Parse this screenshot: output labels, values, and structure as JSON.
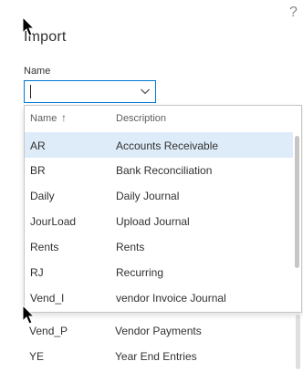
{
  "dialog": {
    "title": "Import",
    "help_icon": "question-mark-icon",
    "help_glyph": "?"
  },
  "name_field": {
    "label": "Name",
    "value": "",
    "icon": "chevron-down-icon"
  },
  "dropdown": {
    "headers": {
      "name": "Name",
      "sort_glyph": "↑",
      "description": "Description"
    },
    "rows": [
      {
        "name": "AR",
        "description": "Accounts Receivable",
        "selected": true
      },
      {
        "name": "BR",
        "description": "Bank Reconciliation"
      },
      {
        "name": "Daily",
        "description": "Daily Journal"
      },
      {
        "name": "JourLoad",
        "description": "Upload Journal"
      },
      {
        "name": "Rents",
        "description": "Rents"
      },
      {
        "name": "RJ",
        "description": "Recurring"
      },
      {
        "name": "Vend_I",
        "description": "vendor Invoice Journal"
      }
    ]
  },
  "background_rows": [
    {
      "name": "Vend_P",
      "description": "Vendor Payments"
    },
    {
      "name": "YE",
      "description": "Year End Entries"
    }
  ],
  "colors": {
    "accent": "#0078d4",
    "selected_row": "#deecf9",
    "text": "#323130"
  }
}
